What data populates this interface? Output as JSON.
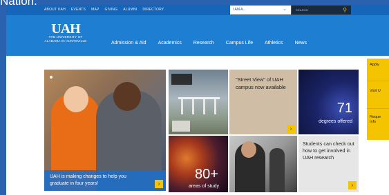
{
  "background_text": "Nation.",
  "util_links": [
    "ABOUT UAH",
    "EVENTS",
    "MAP",
    "GIVING",
    "ALUMNI",
    "DIRECTORY"
  ],
  "i_am": {
    "label": "I AM A..."
  },
  "search": {
    "label": "SEARCH"
  },
  "logo": {
    "mark": "UAH",
    "line1": "THE UNIVERSITY OF",
    "line2": "ALABAMA IN HUNTSVILLE"
  },
  "main_nav": [
    "Admission & Aid",
    "Academics",
    "Research",
    "Campus Life",
    "Athletics",
    "News"
  ],
  "hero": {
    "caption": "UAH is making changes to help you graduate in four years!"
  },
  "tiles": {
    "street_view": "\"Street View\" of UAH campus now available",
    "degrees": {
      "number": "71",
      "label": "degrees offered"
    },
    "areas": {
      "number": "80+",
      "label": "areas of study"
    },
    "student": "Students can check out how to get involved in UAH research"
  },
  "side_panel": [
    "Apply",
    "Visit U",
    "Reque Info"
  ],
  "colors": {
    "header": "#1e7fd2",
    "accent": "#f5c400",
    "hero_caption": "#1e6ec8"
  }
}
